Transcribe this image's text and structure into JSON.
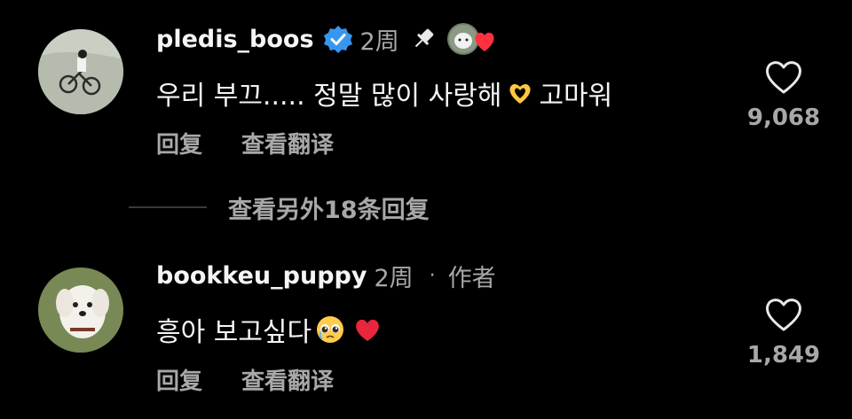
{
  "comments": [
    {
      "username": "pledis_boos",
      "verified": true,
      "time": "2周",
      "pinned": true,
      "text_before": "우리 부끄..... 정말 많이 사랑해",
      "text_after": " 고마워",
      "emoji": "heart-hands-icon",
      "actions": {
        "reply": "回复",
        "translate": "查看翻译"
      },
      "likes": "9,068"
    },
    {
      "username": "bookkeu_puppy",
      "time": "2周",
      "separator": "·",
      "author_badge": "作者",
      "text_before": "흥아 보고싶다",
      "emoji_1": "pleading-face-icon",
      "emoji_2": "red-heart-icon",
      "actions": {
        "reply": "回复",
        "translate": "查看翻译"
      },
      "likes": "1,849"
    }
  ],
  "more_replies": "查看另外18条回复",
  "colors": {
    "background": "#000000",
    "primary_text": "#f5f5f5",
    "secondary_text": "#a8a8a8",
    "verified": "#3797f0",
    "heart": "#ff3040"
  }
}
